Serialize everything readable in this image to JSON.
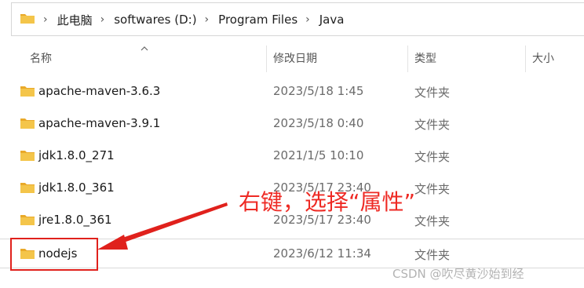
{
  "address_bar": {
    "crumbs": [
      "此电脑",
      "softwares (D:)",
      "Program Files",
      "Java"
    ],
    "separator": "›"
  },
  "columns": {
    "name": "名称",
    "modified": "修改日期",
    "type": "类型",
    "size": "大小"
  },
  "files": [
    {
      "name": "apache-maven-3.6.3",
      "modified": "2023/5/18 1:45",
      "type": "文件夹"
    },
    {
      "name": "apache-maven-3.9.1",
      "modified": "2023/5/18 0:40",
      "type": "文件夹"
    },
    {
      "name": "jdk1.8.0_271",
      "modified": "2021/1/5 10:10",
      "type": "文件夹"
    },
    {
      "name": "jdk1.8.0_361",
      "modified": "2023/5/17 23:40",
      "type": "文件夹"
    },
    {
      "name": "jre1.8.0_361",
      "modified": "2023/5/17 23:40",
      "type": "文件夹"
    },
    {
      "name": "nodejs",
      "modified": "2023/6/12 11:34",
      "type": "文件夹"
    }
  ],
  "annotation": {
    "text": "右键，选择“属性”",
    "color": "#ee2a24"
  },
  "watermark": "CSDN @吹尽黄沙始到经",
  "colors": {
    "folder_body": "#f4c54a",
    "folder_tab": "#e9a929",
    "annotation_red": "#e0211c"
  }
}
